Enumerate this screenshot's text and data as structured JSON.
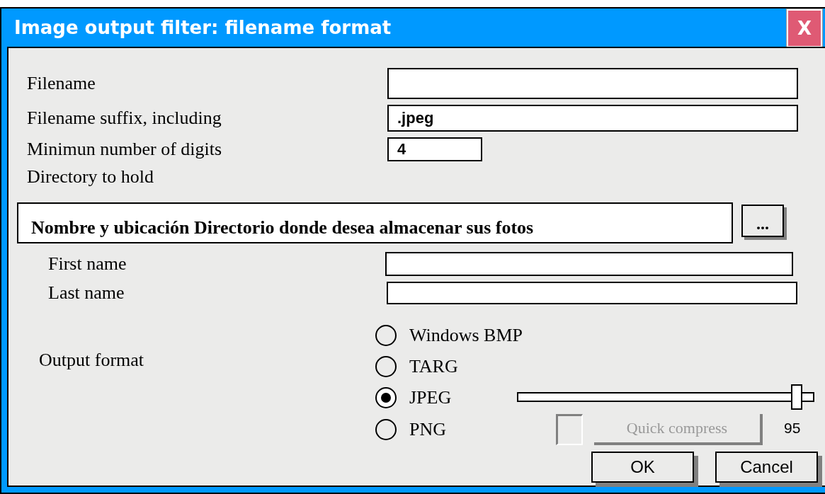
{
  "window": {
    "title": "Image output filter: filename format",
    "close_label": "X"
  },
  "fields": [
    {
      "label": "Filename"
    },
    {
      "label": "Filename suffix, including",
      "value": ".jpeg"
    },
    {
      "label": "Minimun number of digits",
      "value": "4"
    }
  ],
  "directory": {
    "label": "Directory to hold",
    "value": "Nombre y ubicación Directorio donde desea almacenar sus fotos",
    "browse_label": "..."
  },
  "names": [
    {
      "label": "First name"
    },
    {
      "label": "Last name"
    }
  ],
  "output_format": {
    "label": "Output format",
    "options": [
      {
        "label": "Windows BMP",
        "selected": false
      },
      {
        "label": "TARG",
        "selected": false
      },
      {
        "label": "JPEG",
        "selected": true
      },
      {
        "label": "PNG",
        "selected": false
      }
    ]
  },
  "quality": {
    "level": 0.95,
    "reading": "95"
  },
  "quick_compress": {
    "label": "Quick compress",
    "checked": false,
    "disabled": true
  },
  "buttons": [
    "OK",
    "Cancel"
  ]
}
